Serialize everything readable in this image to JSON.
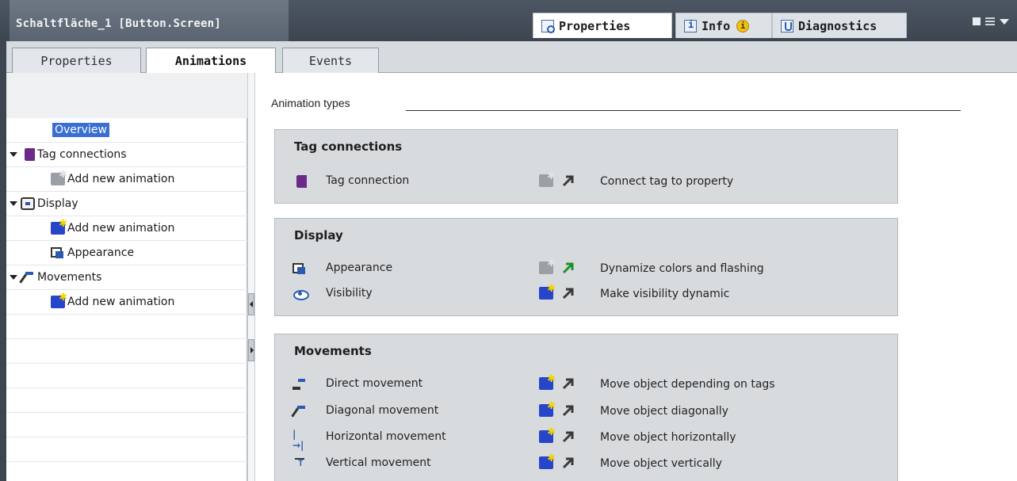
{
  "window": {
    "title": "Schaltfläche_1 [Button.Screen]",
    "inspector_tabs": [
      {
        "label": "Properties",
        "active": true
      },
      {
        "label": "Info",
        "active": false,
        "badge": "i"
      },
      {
        "label": "Diagnostics",
        "active": false
      }
    ]
  },
  "subtabs": [
    {
      "label": "Properties",
      "active": false
    },
    {
      "label": "Animations",
      "active": true
    },
    {
      "label": "Events",
      "active": false
    }
  ],
  "tree": {
    "overview": "Overview",
    "groups": [
      {
        "label": "Tag connections",
        "icon": "tag-icon",
        "children": [
          "Add new animation"
        ]
      },
      {
        "label": "Display",
        "icon": "display-icon",
        "children": [
          "Add new animation",
          "Appearance"
        ]
      },
      {
        "label": "Movements",
        "icon": "movement-icon",
        "children": [
          "Add new animation"
        ]
      }
    ]
  },
  "content": {
    "section_title": "Animation types",
    "groups": [
      {
        "title": "Tag connections",
        "rows": [
          {
            "label": "Tag connection",
            "icon": "tag-icon",
            "new_enabled": false,
            "arrow_color": "#3a3a3a",
            "description": "Connect tag to property"
          }
        ]
      },
      {
        "title": "Display",
        "rows": [
          {
            "label": "Appearance",
            "icon": "appearance-icon",
            "new_enabled": false,
            "arrow_color": "#1f8f2a",
            "description": "Dynamize colors and flashing"
          },
          {
            "label": "Visibility",
            "icon": "visibility-icon",
            "new_enabled": true,
            "arrow_color": "#3a3a3a",
            "description": "Make visibility dynamic"
          }
        ]
      },
      {
        "title": "Movements",
        "rows": [
          {
            "label": "Direct movement",
            "icon": "direct-movement-icon",
            "new_enabled": true,
            "arrow_color": "#3a3a3a",
            "description": "Move object depending on tags"
          },
          {
            "label": "Diagonal movement",
            "icon": "diagonal-movement-icon",
            "new_enabled": true,
            "arrow_color": "#3a3a3a",
            "description": "Move object diagonally"
          },
          {
            "label": "Horizontal movement",
            "icon": "horizontal-movement-icon",
            "new_enabled": true,
            "arrow_color": "#3a3a3a",
            "description": "Move object horizontally"
          },
          {
            "label": "Vertical movement",
            "icon": "vertical-movement-icon",
            "new_enabled": true,
            "arrow_color": "#3a3a3a",
            "description": "Move object vertically"
          }
        ]
      }
    ]
  }
}
